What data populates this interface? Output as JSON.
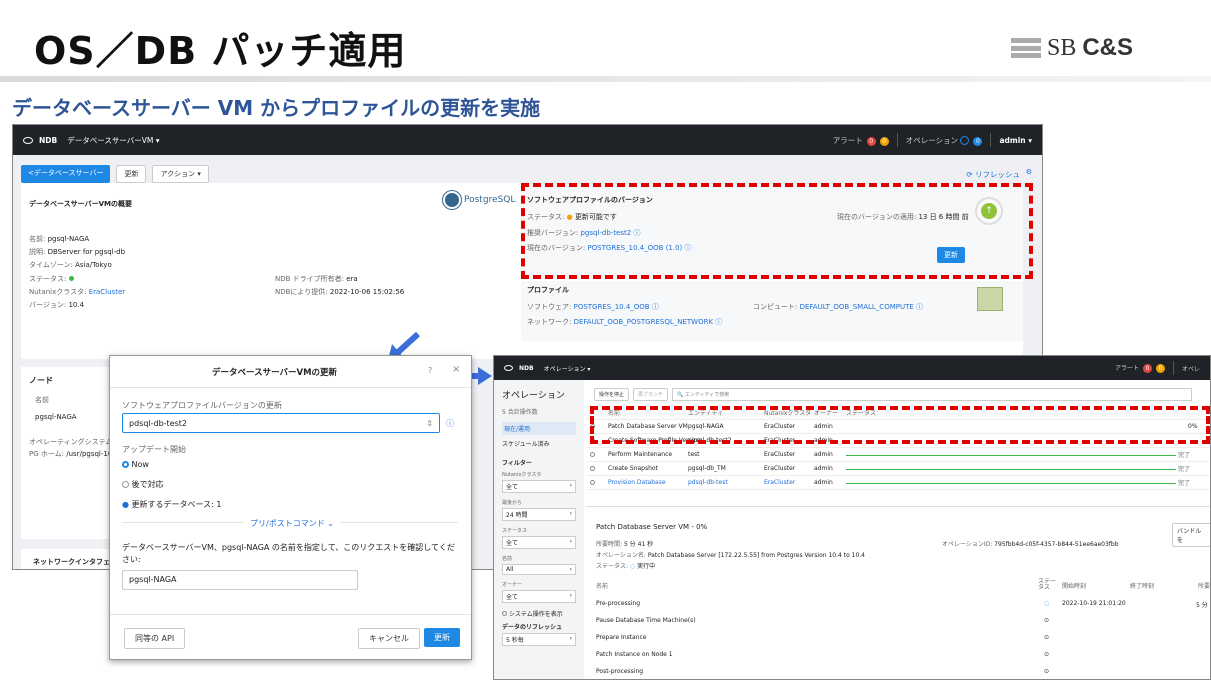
{
  "slide": {
    "title": "OS／DB パッチ適用",
    "subtitle": "データベースサーバー VM からプロファイルの更新を実施",
    "logo_prefix": "SB",
    "logo_suffix": "C&S"
  },
  "s1": {
    "nav": {
      "brand": "NDB",
      "section": "データベースサーバーVM",
      "alert": "アラート",
      "alert_count1": "0",
      "alert_count2": "0",
      "ops": "オペレーション",
      "ops_count": "0",
      "user": "admin"
    },
    "toolbar": {
      "back": "<データベースサーバー",
      "update": "更新",
      "action": "アクション",
      "refresh": "リフレッシュ"
    },
    "overview": {
      "title": "データベースサーバーVMの概要",
      "logo": "PostgreSQL",
      "name_l": "名前:",
      "name": "pgsql-NAGA",
      "desc_l": "説明:",
      "desc": "DBServer for pgsql-db",
      "tz_l": "タイムゾーン:",
      "tz": "Asia/Tokyo",
      "status_l": "ステータス:",
      "cluster_l": "Nutanixクラスタ:",
      "cluster": "EraCluster",
      "ver_l": "バージョン:",
      "ver": "10.4",
      "owner_l": "NDB ドライブ所有者:",
      "owner": "era",
      "prov_l": "NDBにより提供:",
      "prov": "2022-10-06 15:02:56"
    },
    "swver": {
      "title": "ソフトウェアプロファイルのバージョン",
      "status_l": "ステータス:",
      "status": "更新可能です",
      "applied_l": "現在のバージョンの適用:",
      "applied": "13 日 6 時間 前",
      "rec_l": "推奨バージョン:",
      "rec": "pgsql-db-test2",
      "cur_l": "現在のバージョン:",
      "cur": "POSTGRES_10.4_OOB (1.0)",
      "btn": "更新"
    },
    "profile": {
      "title": "プロファイル",
      "sw_l": "ソフトウェア:",
      "sw": "POSTGRES_10.4_OOB",
      "comp_l": "コンピュート:",
      "comp": "DEFAULT_OOB_SMALL_COMPUTE",
      "net_l": "ネットワーク:",
      "net": "DEFAULT_OOB_POSTGRESQL_NETWORK"
    },
    "node": {
      "title": "ノード",
      "col": "名前",
      "name": "pgsql-NAGA",
      "os": "オペレーティングシステム",
      "pg_l": "PG ホーム:",
      "pg": "/usr/pgsql-10.4"
    },
    "netif": "ネットワークインタフェース"
  },
  "dialog": {
    "title": "データベースサーバーVMの更新",
    "help": "?",
    "close": "×",
    "sw_label": "ソフトウェアプロファイルバージョンの更新",
    "sw_value": "pdsql-db-test2",
    "start_label": "アップデート開始",
    "opt_now": "Now",
    "opt_later": "後で対応",
    "dbs": "更新するデータベース: 1",
    "prepost": "プリ/ポストコマンド",
    "confirm": "データベースサーバーVM、pgsql-NAGA の名前を指定して、このリクエストを確認してください:",
    "input": "pgsql-NAGA",
    "api": "同等の API",
    "cancel": "キャンセル",
    "update": "更新"
  },
  "s2": {
    "nav": {
      "brand": "NDB",
      "section": "オペレーション",
      "alert": "アラート",
      "alert_count1": "0",
      "alert_count2": "0",
      "ops": "オペレ"
    },
    "side": {
      "title": "オペレーション",
      "sub": "5 合計操作数",
      "cur": "現在/運用",
      "sched": "スケジュール済み",
      "filter": "フィルター",
      "f1": "Nutanixクラスタ",
      "v1": "全て",
      "f2": "最後から",
      "v2": "24 時間",
      "f3": "ステータス",
      "v3": "全て",
      "f4": "名前",
      "v4": "All",
      "f5": "オーナー",
      "v5": "全て",
      "sys": "システム操作を表示",
      "refresh": "データのリフレッシュ",
      "rv": "5 秒毎"
    },
    "toolbar": {
      "b1": "操作を停止",
      "b2": "再ブランチ",
      "search": "エンティティで検索"
    },
    "cols": {
      "name": "名前",
      "entity": "エンティティ",
      "cluster": "Nutanixクラスタ",
      "owner": "オーナー",
      "status": "ステータス"
    },
    "rows": [
      {
        "name": "Patch Database Server VM",
        "entity": "pgsql-NAGA",
        "cluster": "EraCluster",
        "owner": "admin",
        "pct": "0%"
      },
      {
        "name": "Create Software Profile Version",
        "entity": "pgsql-db-test2",
        "cluster": "EraCluster",
        "owner": "admin",
        "pct": ""
      },
      {
        "name": "Perform Maintenance",
        "entity": "test",
        "cluster": "EraCluster",
        "owner": "admin",
        "pct": "完了"
      },
      {
        "name": "Create Snapshot",
        "entity": "pgsql-db_TM",
        "cluster": "EraCluster",
        "owner": "admin",
        "pct": "完了"
      },
      {
        "name": "Provision Database",
        "entity": "pdsql-db-test",
        "cluster": "EraCluster",
        "owner": "admin",
        "pct": "完了"
      }
    ],
    "detail": {
      "title": "Patch Database Server VM",
      "pct": "0%",
      "elapsed_l": "所要時間:",
      "elapsed": "5 分 41 秒",
      "opid_l": "オペレーションID:",
      "opid": "795fbb4d-c05f-4357-b844-51ee6ae03fbb",
      "opname_l": "オペレーション名:",
      "opname": "Patch Database Server [172.22.5.55] from Postgres Version 10.4 to 10.4",
      "st_l": "ステータス:",
      "st": "実行中",
      "bundle": "バンドルを",
      "c_name": "名前",
      "c_status": "ステータス",
      "c_start": "開始時刻",
      "c_end": "終了時刻",
      "c_dur": "所要",
      "steps": [
        "Pre-processing",
        "Pause Database Time Machine(s)",
        "Prepare Instance",
        "Patch Instance on Node 1",
        "Post-processing"
      ],
      "step1_time": "2022-10-19 21:01:20",
      "step1_dur": "5 分"
    }
  }
}
